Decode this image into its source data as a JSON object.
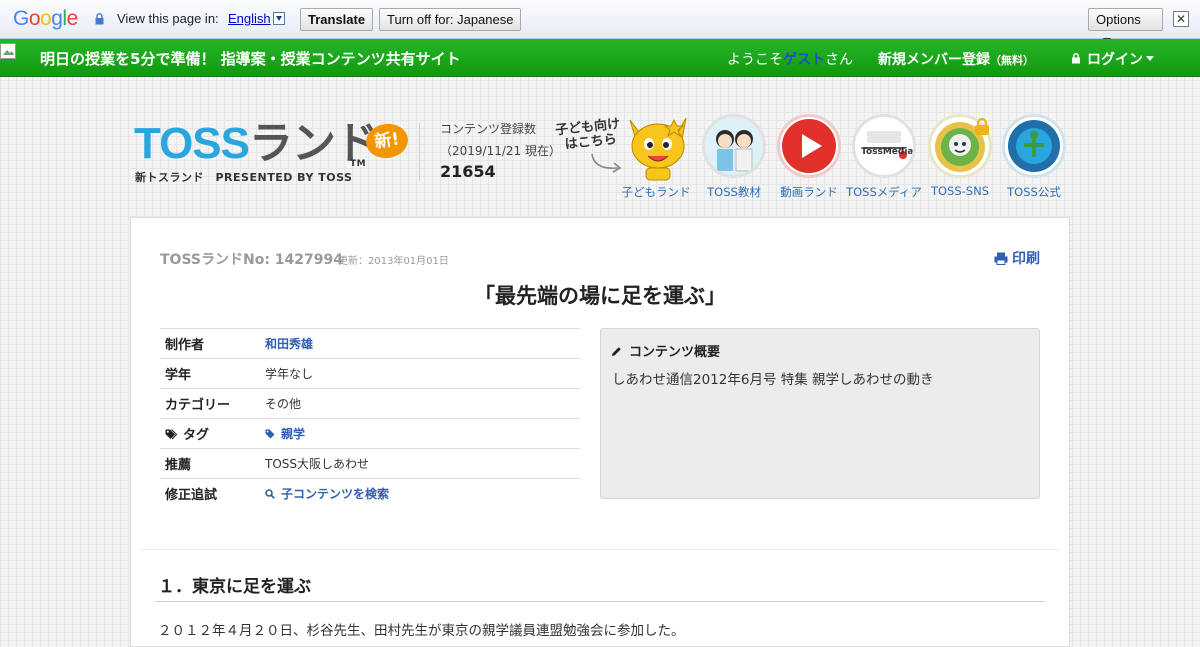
{
  "translate_bar": {
    "logo_letters": [
      "G",
      "o",
      "o",
      "g",
      "l",
      "e"
    ],
    "view_label": "View this page in:",
    "language": "English",
    "translate_button": "Translate",
    "turn_off_button": "Turn off for: Japanese",
    "options_button": "Options",
    "close_symbol": "✕"
  },
  "navbar": {
    "title": "明日の授業を5分で準備！ 指導案・授業コンテンツ共有サイト",
    "welcome_prefix": "ようこそ",
    "guest": "ゲスト",
    "welcome_suffix": "さん",
    "register": "新規メンバー登録",
    "register_free": "（無料）",
    "login": "ログイン"
  },
  "header": {
    "logo_main": "TOSS",
    "logo_land": "ランド",
    "logo_badge": "新!",
    "logo_sub": "新トスランド　PRESENTED BY TOSS",
    "logo_tm": "TM",
    "count_label": "コンテンツ登録数",
    "count_date": "（2019/11/21 現在）",
    "count_value": "21654",
    "kids_note_line1": "子ども向け",
    "kids_note_line2": "はこちら",
    "links": [
      {
        "label": "子どもランド"
      },
      {
        "label": "TOSS教材"
      },
      {
        "label": "動画ランド"
      },
      {
        "label": "TOSSメディア"
      },
      {
        "label": "TOSS-SNS"
      },
      {
        "label": "TOSS公式"
      }
    ],
    "media_logo_text": "TossMedia"
  },
  "article": {
    "toss_no": "TOSSランドNo: 1427994",
    "updated": "更新：2013年01月01日",
    "print": "印刷",
    "title": "「最先端の場に足を運ぶ」",
    "meta": {
      "author_label": "制作者",
      "author": "和田秀雄",
      "grade_label": "学年",
      "grade": "学年なし",
      "category_label": "カテゴリー",
      "category": "その他",
      "tag_label": "タグ",
      "tag": "親学",
      "recommend_label": "推薦",
      "recommend": "TOSS大阪しあわせ",
      "revision_label": "修正追試",
      "revision_link": "子コンテンツを検索"
    },
    "summary_heading": "コンテンツ概要",
    "summary_text": "しあわせ通信2012年6月号 特集 親学しあわせの動き",
    "section_heading": "１．東京に足を運ぶ",
    "body_text": "２０１２年４月２０日、杉谷先生、田村先生が東京の親学議員連盟勉強会に参加した。"
  },
  "colors": {
    "nav_green": "#14a014",
    "link_blue": "#2f5fb0",
    "guest_blue": "#1f4fc9",
    "logo_blue": "#2aa6df",
    "badge_orange": "#f29600"
  },
  "icons": [
    "lock-icon",
    "dropdown-arrow-icon",
    "close-icon",
    "broken-image-icon",
    "login-lock-icon",
    "print-icon",
    "tag-icon",
    "search-icon",
    "pencil-icon"
  ]
}
